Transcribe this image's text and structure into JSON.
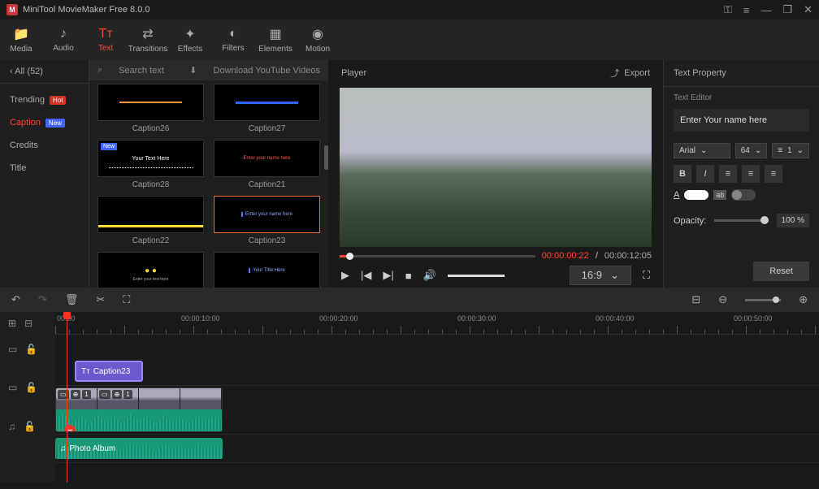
{
  "app": {
    "title": "MiniTool MovieMaker Free 8.0.0"
  },
  "toolbar": {
    "items": [
      {
        "label": "Media",
        "icon": "📁"
      },
      {
        "label": "Audio",
        "icon": "♪"
      },
      {
        "label": "Text",
        "icon": "Tᴛ"
      },
      {
        "label": "Transitions",
        "icon": "⇄"
      },
      {
        "label": "Effects",
        "icon": "✦"
      },
      {
        "label": "Filters",
        "icon": "◐"
      },
      {
        "label": "Elements",
        "icon": "▦"
      },
      {
        "label": "Motion",
        "icon": "◉"
      }
    ]
  },
  "categories": {
    "header": "All (52)",
    "items": [
      {
        "label": "Trending",
        "badge": "Hot",
        "badgeClass": "badge-hot"
      },
      {
        "label": "Caption",
        "badge": "New",
        "badgeClass": "badge-new",
        "active": true
      },
      {
        "label": "Credits"
      },
      {
        "label": "Title"
      }
    ]
  },
  "library": {
    "search": "Search text",
    "download": "Download YouTube Videos",
    "items": [
      {
        "label": "Caption26"
      },
      {
        "label": "Caption27"
      },
      {
        "label": "Caption28",
        "thumbText": "Your Text Here"
      },
      {
        "label": "Caption21",
        "thumbText": "Enter your name here"
      },
      {
        "label": "Caption22"
      },
      {
        "label": "Caption23",
        "thumbText": "Enter your name here",
        "selected": true
      },
      {
        "label": ""
      },
      {
        "label": "",
        "thumbText": "Your Title Here"
      }
    ]
  },
  "player": {
    "title": "Player",
    "export": "Export",
    "currentTime": "00:00:00:22",
    "totalTime": "00:00:12:05",
    "aspect": "16:9"
  },
  "textProp": {
    "header": "Text Property",
    "editorLabel": "Text Editor",
    "editorText": "Enter Your name here",
    "font": "Arial",
    "size": "64",
    "spacing": "1",
    "opacityLabel": "Opacity:",
    "opacity": "100 %",
    "reset": "Reset"
  },
  "timeline": {
    "ruler": [
      "00:00:10:00",
      "00:00:20:00",
      "00:00:30:00",
      "00:00:40:00",
      "00:00:50:00"
    ],
    "rulerZero": "00:00",
    "captionClip": "Caption23",
    "videoClipNum": "1",
    "audioClip": "Photo Album"
  }
}
